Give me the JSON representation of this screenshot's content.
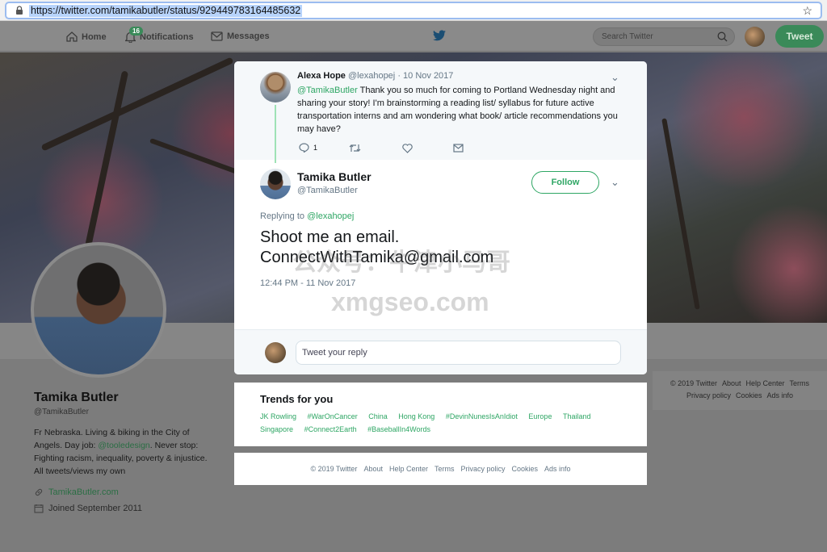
{
  "browser": {
    "url": "https://twitter.com/tamikabutler/status/929449783164485632"
  },
  "nav": {
    "home_label": "Home",
    "notifications_label": "Notifications",
    "notifications_badge": "16",
    "messages_label": "Messages",
    "search_placeholder": "Search Twitter",
    "tweet_button": "Tweet"
  },
  "profile": {
    "name": "Tamika Butler",
    "handle": "@TamikaButler",
    "bio_prefix": "Fr Nebraska. Living & biking in the City of Angels. Day job: ",
    "bio_link": "@tooledesign",
    "bio_suffix": ". Never stop: Fighting racism, inequality, poverty & injustice. All tweets/views my own",
    "website": "TamikaButler.com",
    "joined": "Joined September 2011"
  },
  "parent_tweet": {
    "author_name": "Alexa Hope",
    "author_handle": "@lexahopej",
    "date": "· 10 Nov 2017",
    "mention": "@TamikaButler",
    "text": " Thank you so much for coming to Portland Wednesday night and sharing your story! I'm brainstorming a reading list/ syllabus for future active transportation interns and am wondering what book/ article recommendations you may have?",
    "reply_count": "1"
  },
  "main_tweet": {
    "author_name": "Tamika Butler",
    "author_handle": "@TamikaButler",
    "follow_label": "Follow",
    "replying_prefix": "Replying to ",
    "replying_to": "@lexahopej",
    "text_line1": "Shoot me an email.",
    "text_line2": "ConnectWithTamika@gmail.com",
    "timestamp": "12:44 PM - 11 Nov 2017"
  },
  "reply_box": {
    "placeholder": "Tweet your reply"
  },
  "trends": {
    "title": "Trends for you",
    "items": [
      "JK Rowling",
      "#WarOnCancer",
      "China",
      "Hong Kong",
      "#DevinNunesIsAnIdiot",
      "Europe",
      "Thailand",
      "Singapore",
      "#Connect2Earth",
      "#BaseballIn4Words"
    ]
  },
  "footer": {
    "copyright": "© 2019 Twitter",
    "about": "About",
    "help": "Help Center",
    "terms": "Terms",
    "privacy": "Privacy policy",
    "cookies": "Cookies",
    "ads": "Ads info"
  },
  "watermark": {
    "line1": "公众号：牛津小马哥",
    "line2": "xmgseo.com"
  },
  "colors": {
    "accent": "#2ea664",
    "overlay_gray": "#7c7c7c"
  }
}
